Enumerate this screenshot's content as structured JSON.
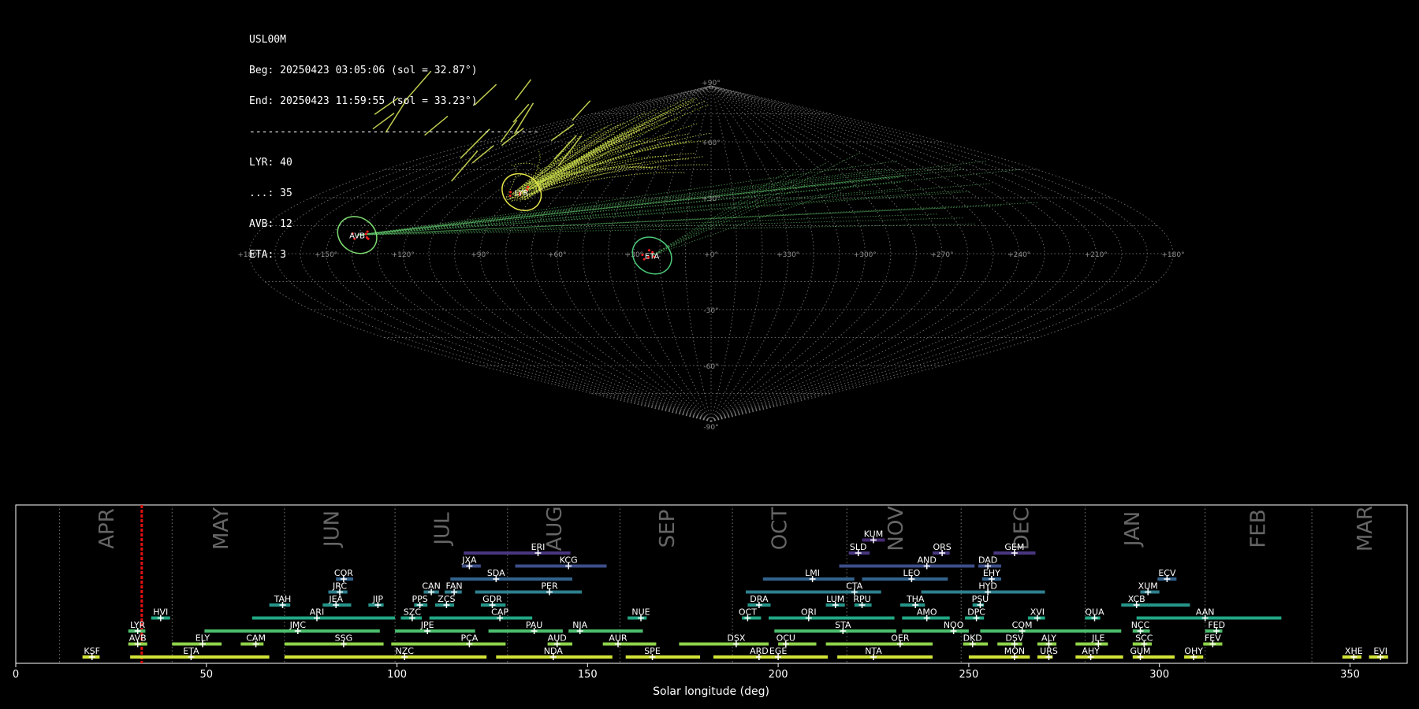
{
  "info": {
    "station": "USL00M",
    "begin": "Beg: 20250423 03:05:06 (sol = 32.87°)",
    "end": "End: 20250423 11:59:55 (sol = 33.23°)",
    "separator": "-----------------------------------------------",
    "counts": [
      "LYR: 40",
      "...: 35",
      "AVB: 12",
      "ETA: 3"
    ]
  },
  "sky_map": {
    "projection": "sinusoidal",
    "lon_ticks": [
      "+180°",
      "+150°",
      "+120°",
      "+90°",
      "+60°",
      "+30°",
      "+0°",
      "+330°",
      "+300°",
      "+270°",
      "+240°",
      "+210°",
      "+180°"
    ],
    "lat_ticks": [
      "+90°",
      "+60°",
      "+30°",
      "-30°",
      "-60°",
      "-90°"
    ],
    "radiants": [
      {
        "label": "LYR",
        "ra": 272,
        "dec": 33,
        "color": "#e6e64a"
      },
      {
        "label": "AVB",
        "ra": 220,
        "dec": 10,
        "color": "#7ddc70"
      },
      {
        "label": "ETA",
        "ra": 337,
        "dec": -1,
        "color": "#4cc878"
      }
    ],
    "colors": {
      "grid": "#8a8a8a",
      "meteor_yellow": "#d4e157",
      "meteor_green": "#5fc36b",
      "radiant_point": "#ff2020"
    }
  },
  "chart_data": {
    "type": "timeline",
    "xlabel": "Solar longitude (deg)",
    "xlim": [
      0,
      365
    ],
    "xticks": [
      "0",
      "50",
      "100",
      "150",
      "200",
      "250",
      "300",
      "350"
    ],
    "current_sol": 33.05,
    "months": [
      {
        "label": "APR",
        "start": 11.5,
        "center": 24
      },
      {
        "label": "MAY",
        "start": 41,
        "center": 54
      },
      {
        "label": "JUN",
        "start": 70.5,
        "center": 83
      },
      {
        "label": "JUL",
        "start": 99.5,
        "center": 112
      },
      {
        "label": "AUG",
        "start": 129,
        "center": 141.5
      },
      {
        "label": "SEP",
        "start": 158.5,
        "center": 171
      },
      {
        "label": "OCT",
        "start": 188,
        "center": 200.5
      },
      {
        "label": "NOV",
        "start": 218,
        "center": 231
      },
      {
        "label": "DEC",
        "start": 248,
        "center": 264
      },
      {
        "label": "JAN",
        "start": 280.5,
        "center": 293
      },
      {
        "label": "FEB",
        "start": 312,
        "center": 326
      },
      {
        "label": "MAR",
        "start": 340,
        "center": 354
      }
    ],
    "showers": [
      {
        "name": "KSF",
        "row": 0,
        "start": 17.5,
        "end": 22,
        "peak": 20,
        "color": "#d2e337"
      },
      {
        "name": "ETA",
        "row": 0,
        "start": 30,
        "end": 66.5,
        "peak": 46,
        "color": "#d2e337"
      },
      {
        "name": "NZC",
        "row": 0,
        "start": 70.5,
        "end": 123.5,
        "peak": 102,
        "color": "#d2e337"
      },
      {
        "name": "NDA",
        "row": 0,
        "start": 126,
        "end": 156.5,
        "peak": 141,
        "color": "#d2e337"
      },
      {
        "name": "SPE",
        "row": 0,
        "start": 160,
        "end": 179.5,
        "peak": 167,
        "color": "#d2e337"
      },
      {
        "name": "ARD",
        "row": 0,
        "start": 183,
        "end": 196,
        "peak": 195,
        "color": "#d2e337"
      },
      {
        "name": "EGE",
        "row": 0,
        "start": 195.5,
        "end": 213,
        "peak": 200,
        "color": "#d2e337"
      },
      {
        "name": "NTA",
        "row": 0,
        "start": 215.5,
        "end": 240.5,
        "peak": 225,
        "color": "#d2e337"
      },
      {
        "name": "MON",
        "row": 0,
        "start": 250,
        "end": 266,
        "peak": 262,
        "color": "#d2e337"
      },
      {
        "name": "URS",
        "row": 0,
        "start": 268,
        "end": 272,
        "peak": 271,
        "color": "#d2e337"
      },
      {
        "name": "AHY",
        "row": 0,
        "start": 278,
        "end": 290.5,
        "peak": 282,
        "color": "#d2e337"
      },
      {
        "name": "GUM",
        "row": 0,
        "start": 293,
        "end": 304,
        "peak": 295,
        "color": "#d2e337"
      },
      {
        "name": "OHY",
        "row": 0,
        "start": 306.5,
        "end": 311.5,
        "peak": 309,
        "color": "#d2e337"
      },
      {
        "name": "XHE",
        "row": 0,
        "start": 348,
        "end": 353,
        "peak": 351,
        "color": "#d2e337"
      },
      {
        "name": "EVI",
        "row": 0,
        "start": 355,
        "end": 360,
        "peak": 358,
        "color": "#d2e337"
      },
      {
        "name": "AVB",
        "row": 1,
        "start": 29.5,
        "end": 34.5,
        "peak": 32,
        "color": "#8fd44b"
      },
      {
        "name": "ELY",
        "row": 1,
        "start": 41,
        "end": 54,
        "peak": 49,
        "color": "#8fd44b"
      },
      {
        "name": "CAM",
        "row": 1,
        "start": 59,
        "end": 65,
        "peak": 63,
        "color": "#8fd44b"
      },
      {
        "name": "SSG",
        "row": 1,
        "start": 70.5,
        "end": 96.5,
        "peak": 86,
        "color": "#8fd44b"
      },
      {
        "name": "PCA",
        "row": 1,
        "start": 98.5,
        "end": 128.5,
        "peak": 119,
        "color": "#8fd44b"
      },
      {
        "name": "AUD",
        "row": 1,
        "start": 139.5,
        "end": 146,
        "peak": 142,
        "color": "#8fd44b"
      },
      {
        "name": "AUR",
        "row": 1,
        "start": 154,
        "end": 168,
        "peak": 158,
        "color": "#8fd44b"
      },
      {
        "name": "DSX",
        "row": 1,
        "start": 174,
        "end": 197.5,
        "peak": 189,
        "color": "#8fd44b"
      },
      {
        "name": "OCU",
        "row": 1,
        "start": 200,
        "end": 210,
        "peak": 202,
        "color": "#8fd44b"
      },
      {
        "name": "OER",
        "row": 1,
        "start": 212.5,
        "end": 240.5,
        "peak": 232,
        "color": "#8fd44b"
      },
      {
        "name": "DKD",
        "row": 1,
        "start": 248.5,
        "end": 255,
        "peak": 251,
        "color": "#8fd44b"
      },
      {
        "name": "DSV",
        "row": 1,
        "start": 257.5,
        "end": 264,
        "peak": 262,
        "color": "#8fd44b"
      },
      {
        "name": "ALY",
        "row": 1,
        "start": 268,
        "end": 273,
        "peak": 271,
        "color": "#8fd44b"
      },
      {
        "name": "JLE",
        "row": 1,
        "start": 278,
        "end": 286.5,
        "peak": 284,
        "color": "#8fd44b"
      },
      {
        "name": "SCC",
        "row": 1,
        "start": 293,
        "end": 298,
        "peak": 296,
        "color": "#8fd44b"
      },
      {
        "name": "FEV",
        "row": 1,
        "start": 311.5,
        "end": 316.5,
        "peak": 314,
        "color": "#8fd44b"
      },
      {
        "name": "LYR",
        "row": 2,
        "start": 29.5,
        "end": 34,
        "peak": 32,
        "color": "#4cbf6e"
      },
      {
        "name": "JMC",
        "row": 2,
        "start": 49.5,
        "end": 95.5,
        "peak": 74,
        "color": "#4cbf6e"
      },
      {
        "name": "JPE",
        "row": 2,
        "start": 99.5,
        "end": 120.5,
        "peak": 108,
        "color": "#4cbf6e"
      },
      {
        "name": "PAU",
        "row": 2,
        "start": 124,
        "end": 143.5,
        "peak": 136,
        "color": "#4cbf6e"
      },
      {
        "name": "NIA",
        "row": 2,
        "start": 145,
        "end": 164.5,
        "peak": 148,
        "color": "#4cbf6e"
      },
      {
        "name": "STA",
        "row": 2,
        "start": 199,
        "end": 231,
        "peak": 217,
        "color": "#4cbf6e"
      },
      {
        "name": "NOO",
        "row": 2,
        "start": 232.5,
        "end": 250,
        "peak": 246,
        "color": "#4cbf6e"
      },
      {
        "name": "COM",
        "row": 2,
        "start": 253,
        "end": 290,
        "peak": 264,
        "color": "#4cbf6e"
      },
      {
        "name": "NCC",
        "row": 2,
        "start": 293,
        "end": 297.5,
        "peak": 295,
        "color": "#4cbf6e"
      },
      {
        "name": "FED",
        "row": 2,
        "start": 312,
        "end": 316.5,
        "peak": 315,
        "color": "#4cbf6e"
      },
      {
        "name": "HVI",
        "row": 3,
        "start": 35.5,
        "end": 40.5,
        "peak": 38,
        "color": "#22a884"
      },
      {
        "name": "ARI",
        "row": 3,
        "start": 62,
        "end": 99.5,
        "peak": 79,
        "color": "#22a884"
      },
      {
        "name": "SZC",
        "row": 3,
        "start": 101,
        "end": 106.5,
        "peak": 104,
        "color": "#22a884"
      },
      {
        "name": "CAP",
        "row": 3,
        "start": 108.5,
        "end": 135.5,
        "peak": 127,
        "color": "#22a884"
      },
      {
        "name": "NUE",
        "row": 3,
        "start": 160.5,
        "end": 165.5,
        "peak": 164,
        "color": "#22a884"
      },
      {
        "name": "OCT",
        "row": 3,
        "start": 190.5,
        "end": 195.5,
        "peak": 192,
        "color": "#22a884"
      },
      {
        "name": "ORI",
        "row": 3,
        "start": 197.5,
        "end": 230.5,
        "peak": 208,
        "color": "#22a884"
      },
      {
        "name": "AMO",
        "row": 3,
        "start": 232.5,
        "end": 245,
        "peak": 239,
        "color": "#22a884"
      },
      {
        "name": "DPC",
        "row": 3,
        "start": 249,
        "end": 254,
        "peak": 252,
        "color": "#22a884"
      },
      {
        "name": "XVI",
        "row": 3,
        "start": 265.5,
        "end": 270,
        "peak": 268,
        "color": "#22a884"
      },
      {
        "name": "QUA",
        "row": 3,
        "start": 280.5,
        "end": 284.5,
        "peak": 283,
        "color": "#22a884"
      },
      {
        "name": "AAN",
        "row": 3,
        "start": 294,
        "end": 332,
        "peak": 312,
        "color": "#22a884"
      },
      {
        "name": "TAH",
        "row": 4,
        "start": 66.5,
        "end": 72,
        "peak": 70,
        "color": "#26958a"
      },
      {
        "name": "JEA",
        "row": 4,
        "start": 80.5,
        "end": 88,
        "peak": 84,
        "color": "#26958a"
      },
      {
        "name": "JIP",
        "row": 4,
        "start": 92.5,
        "end": 96.5,
        "peak": 95,
        "color": "#26958a"
      },
      {
        "name": "PPS",
        "row": 4,
        "start": 104.5,
        "end": 108,
        "peak": 106,
        "color": "#26958a"
      },
      {
        "name": "ZCS",
        "row": 4,
        "start": 110,
        "end": 115,
        "peak": 113,
        "color": "#26958a"
      },
      {
        "name": "GDR",
        "row": 4,
        "start": 122,
        "end": 128.5,
        "peak": 125,
        "color": "#26958a"
      },
      {
        "name": "DRA",
        "row": 4,
        "start": 192,
        "end": 198,
        "peak": 195,
        "color": "#26958a"
      },
      {
        "name": "LUM",
        "row": 4,
        "start": 212.5,
        "end": 217.5,
        "peak": 215,
        "color": "#26958a"
      },
      {
        "name": "RPU",
        "row": 4,
        "start": 220,
        "end": 224.5,
        "peak": 222,
        "color": "#26958a"
      },
      {
        "name": "THA",
        "row": 4,
        "start": 232,
        "end": 238.5,
        "peak": 236,
        "color": "#26958a"
      },
      {
        "name": "PSU",
        "row": 4,
        "start": 251,
        "end": 254,
        "peak": 253,
        "color": "#26958a"
      },
      {
        "name": "XCB",
        "row": 4,
        "start": 290,
        "end": 308,
        "peak": 294,
        "color": "#26958a"
      },
      {
        "name": "JRC",
        "row": 5,
        "start": 82,
        "end": 87,
        "peak": 85,
        "color": "#2e7f8e"
      },
      {
        "name": "CAN",
        "row": 5,
        "start": 107,
        "end": 111,
        "peak": 109,
        "color": "#2e7f8e"
      },
      {
        "name": "FAN",
        "row": 5,
        "start": 112.5,
        "end": 117,
        "peak": 115,
        "color": "#2e7f8e"
      },
      {
        "name": "PER",
        "row": 5,
        "start": 120.5,
        "end": 148.5,
        "peak": 140,
        "color": "#2e7f8e"
      },
      {
        "name": "CTA",
        "row": 5,
        "start": 191.5,
        "end": 227,
        "peak": 220,
        "color": "#2e7f8e"
      },
      {
        "name": "HYD",
        "row": 5,
        "start": 237.5,
        "end": 270,
        "peak": 255,
        "color": "#2e7f8e"
      },
      {
        "name": "XUM",
        "row": 5,
        "start": 295,
        "end": 300,
        "peak": 297,
        "color": "#2e7f8e"
      },
      {
        "name": "COR",
        "row": 6,
        "start": 84,
        "end": 88.5,
        "peak": 86,
        "color": "#33638d"
      },
      {
        "name": "SDA",
        "row": 6,
        "start": 114,
        "end": 146,
        "peak": 126,
        "color": "#33638d"
      },
      {
        "name": "LMI",
        "row": 6,
        "start": 196,
        "end": 220,
        "peak": 209,
        "color": "#33638d"
      },
      {
        "name": "LEO",
        "row": 6,
        "start": 222,
        "end": 244.5,
        "peak": 235,
        "color": "#33638d"
      },
      {
        "name": "EHY",
        "row": 6,
        "start": 253.5,
        "end": 258.5,
        "peak": 256,
        "color": "#33638d"
      },
      {
        "name": "ECV",
        "row": 6,
        "start": 299.5,
        "end": 304.5,
        "peak": 302,
        "color": "#33638d"
      },
      {
        "name": "JXA",
        "row": 7,
        "start": 117,
        "end": 122,
        "peak": 119,
        "color": "#3d4e8a"
      },
      {
        "name": "KCG",
        "row": 7,
        "start": 131,
        "end": 155,
        "peak": 145,
        "color": "#3d4e8a"
      },
      {
        "name": "AND",
        "row": 7,
        "start": 216,
        "end": 251.5,
        "peak": 239,
        "color": "#3d4e8a"
      },
      {
        "name": "DAD",
        "row": 7,
        "start": 252.5,
        "end": 258.5,
        "peak": 255,
        "color": "#3d4e8a"
      },
      {
        "name": "ERI",
        "row": 8,
        "start": 117.5,
        "end": 145.5,
        "peak": 137,
        "color": "#48367f"
      },
      {
        "name": "SLD",
        "row": 8,
        "start": 218.5,
        "end": 224,
        "peak": 221,
        "color": "#48367f"
      },
      {
        "name": "ORS",
        "row": 8,
        "start": 240.5,
        "end": 245,
        "peak": 243,
        "color": "#48367f"
      },
      {
        "name": "GEM",
        "row": 8,
        "start": 256.5,
        "end": 267.5,
        "peak": 262,
        "color": "#48367f"
      },
      {
        "name": "KUM",
        "row": 9,
        "start": 222,
        "end": 228,
        "peak": 225,
        "color": "#452a73"
      }
    ]
  }
}
